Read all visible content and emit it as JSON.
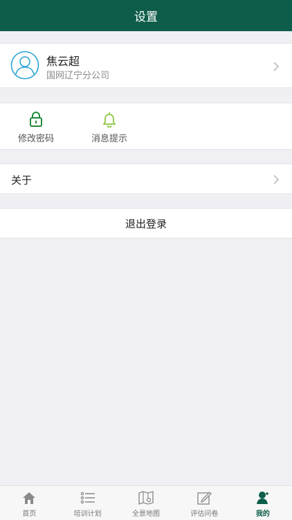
{
  "header": {
    "title": "设置"
  },
  "profile": {
    "name": "焦云超",
    "org": "国网辽宁分公司"
  },
  "actions": [
    {
      "label": "修改密码",
      "icon": "lock-icon",
      "color": "#1f8a3a"
    },
    {
      "label": "消息提示",
      "icon": "bell-icon",
      "color": "#8cc63f"
    }
  ],
  "about": {
    "label": "关于"
  },
  "logout": {
    "label": "退出登录"
  },
  "tabbar": {
    "tabs": [
      {
        "label": "首页",
        "icon": "home-icon"
      },
      {
        "label": "培训计划",
        "icon": "list-icon"
      },
      {
        "label": "全景地图",
        "icon": "map-icon"
      },
      {
        "label": "评估问卷",
        "icon": "edit-icon"
      },
      {
        "label": "我的",
        "icon": "user-icon",
        "active": true
      }
    ]
  },
  "colors": {
    "header": "#0e5d4a",
    "accent": "#0e5d4a",
    "avatar": "#2aa3d6"
  }
}
